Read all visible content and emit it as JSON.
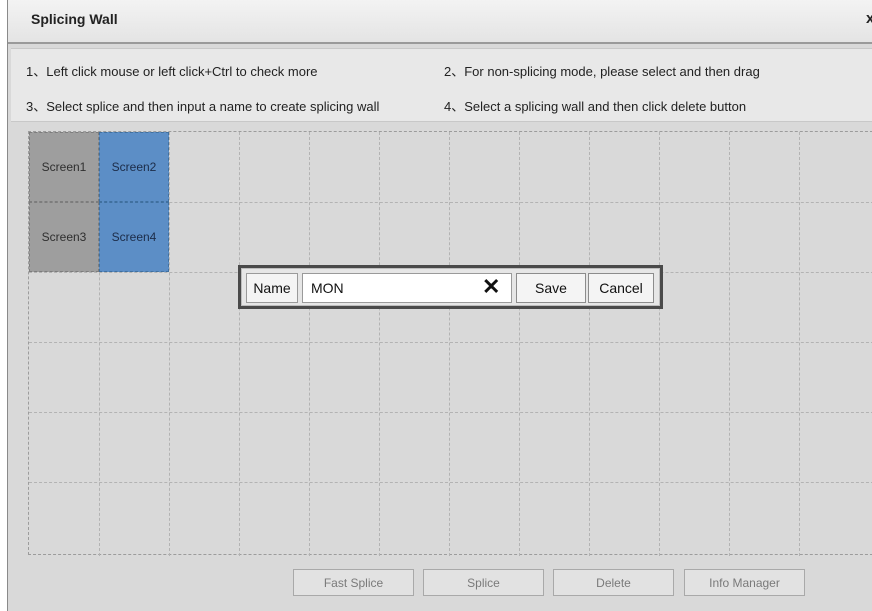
{
  "dialog": {
    "title": "Splicing Wall",
    "close_glyph": "x"
  },
  "instructions": [
    "1、Left click mouse or left click+Ctrl to check more",
    "2、For non-splicing mode, please select and then drag",
    "3、Select splice and then input a name to create splicing wall",
    "4、Select a splicing wall and then click delete button"
  ],
  "screens": [
    {
      "label": "Screen1",
      "state": "grey"
    },
    {
      "label": "Screen2",
      "state": "blue"
    },
    {
      "label": "Screen3",
      "state": "grey"
    },
    {
      "label": "Screen4",
      "state": "blue"
    }
  ],
  "name_bar": {
    "label": "Name",
    "value": "MON",
    "clear_glyph": "✕",
    "save_label": "Save",
    "cancel_label": "Cancel"
  },
  "footer": {
    "fast_splice": "Fast Splice",
    "splice": "Splice",
    "delete": "Delete",
    "info_manager": "Info Manager"
  },
  "colors": {
    "selected": "#5c8ec6",
    "unselected": "#9e9e9e",
    "background": "#d9d9d9"
  },
  "icons": [
    "close-icon",
    "clear-icon"
  ]
}
